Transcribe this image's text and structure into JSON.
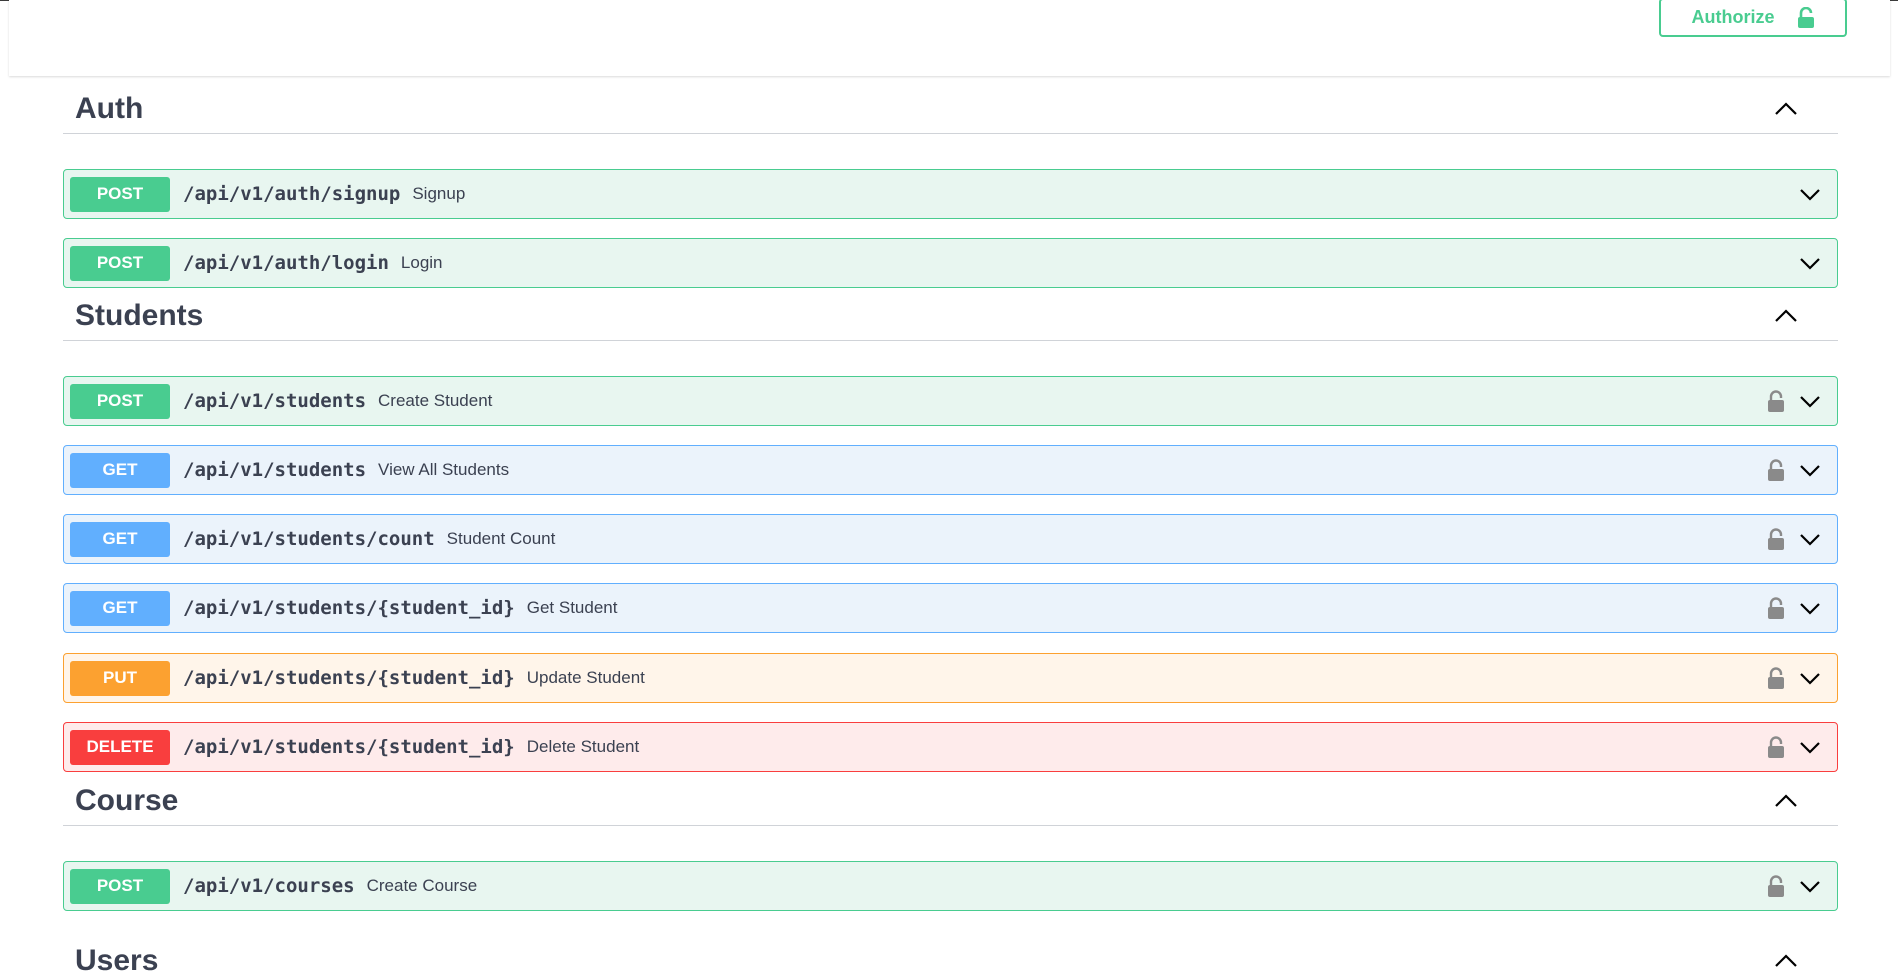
{
  "header": {
    "authorize_label": "Authorize"
  },
  "colors": {
    "post": "#49cc90",
    "get": "#61affe",
    "put": "#fca130",
    "delete": "#f93e3e",
    "text": "#3b4151"
  },
  "tags": [
    {
      "name": "Auth",
      "operations": [
        {
          "method": "POST",
          "path": "/api/v1/auth/signup",
          "summary": "Signup",
          "locked": false
        },
        {
          "method": "POST",
          "path": "/api/v1/auth/login",
          "summary": "Login",
          "locked": false
        }
      ]
    },
    {
      "name": "Students",
      "operations": [
        {
          "method": "POST",
          "path": "/api/v1/students",
          "summary": "Create Student",
          "locked": true
        },
        {
          "method": "GET",
          "path": "/api/v1/students",
          "summary": "View All Students",
          "locked": true
        },
        {
          "method": "GET",
          "path": "/api/v1/students/count",
          "summary": "Student Count",
          "locked": true
        },
        {
          "method": "GET",
          "path": "/api/v1/students/{student_id}",
          "summary": "Get Student",
          "locked": true
        },
        {
          "method": "PUT",
          "path": "/api/v1/students/{student_id}",
          "summary": "Update Student",
          "locked": true
        },
        {
          "method": "DELETE",
          "path": "/api/v1/students/{student_id}",
          "summary": "Delete Student",
          "locked": true
        }
      ]
    },
    {
      "name": "Course",
      "operations": [
        {
          "method": "POST",
          "path": "/api/v1/courses",
          "summary": "Create Course",
          "locked": true
        }
      ]
    },
    {
      "name": "Users",
      "operations": []
    }
  ]
}
